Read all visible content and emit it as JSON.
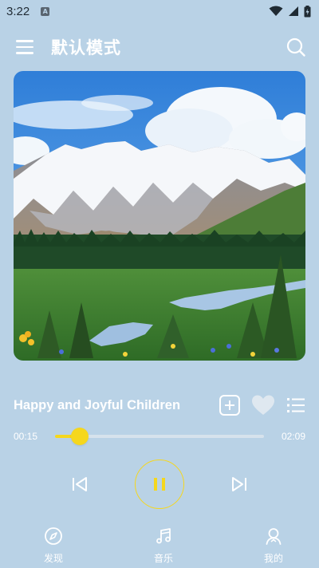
{
  "status_bar": {
    "time": "3:22",
    "app_icon_letter": "A"
  },
  "header": {
    "title": "默认模式"
  },
  "song": {
    "title": "Happy and Joyful Children",
    "favorited": false
  },
  "playback": {
    "elapsed": "00:15",
    "duration": "02:09",
    "progress": 0.12,
    "state": "playing"
  },
  "bottom_nav": {
    "items": [
      {
        "label": "发现",
        "icon": "compass-icon"
      },
      {
        "label": "音乐",
        "icon": "music-note-icon"
      },
      {
        "label": "我的",
        "icon": "person-icon"
      }
    ]
  },
  "colors": {
    "background": "#b9d2e6",
    "accent": "#f5d71e",
    "text": "#ffffff"
  }
}
